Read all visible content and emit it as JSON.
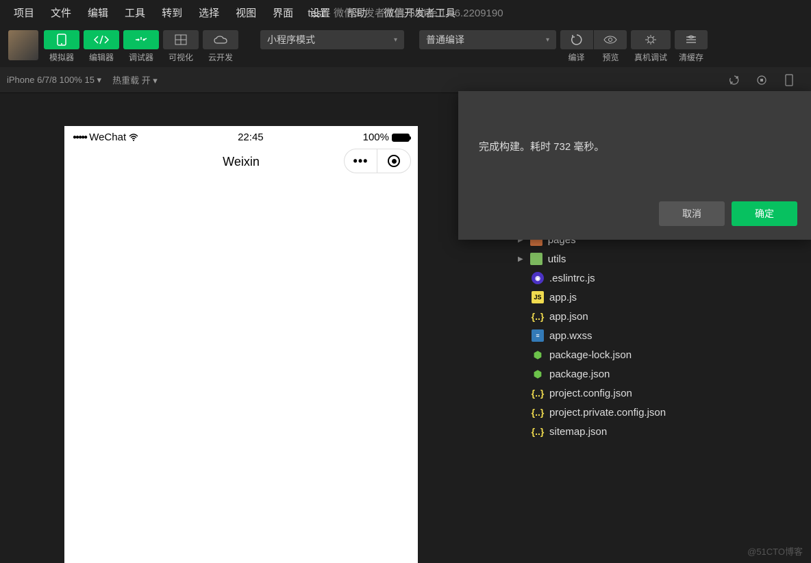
{
  "menubar": [
    "项目",
    "文件",
    "编辑",
    "工具",
    "转到",
    "选择",
    "视图",
    "界面",
    "设置",
    "帮助",
    "微信开发者工具"
  ],
  "window_title": {
    "project": "test",
    "suffix": " - 微信开发者工具 Stable 1.06.2209190"
  },
  "toolbar": {
    "simulator": "模拟器",
    "editor": "编辑器",
    "debugger": "调试器",
    "visualize": "可视化",
    "cloud": "云开发",
    "mode_dropdown": "小程序模式",
    "compile_dropdown": "普通编译",
    "compile": "编译",
    "preview": "预览",
    "real_device": "真机调试",
    "clear_cache": "清缓存"
  },
  "subbar": {
    "device": "iPhone 6/7/8 100% 15 ▾",
    "hot_reload": "热重载 开 ▾"
  },
  "phone": {
    "carrier": "WeChat",
    "time": "22:45",
    "battery": "100%",
    "page_title": "Weixin"
  },
  "modal": {
    "message": "完成构建。耗时 732 毫秒。",
    "cancel": "取消",
    "ok": "确定"
  },
  "tree": {
    "folders": [
      {
        "name": "pages",
        "color": "o"
      },
      {
        "name": "utils",
        "color": "g"
      }
    ],
    "files": [
      {
        "name": ".eslintrc.js",
        "icon": "eslint"
      },
      {
        "name": "app.js",
        "icon": "js"
      },
      {
        "name": "app.json",
        "icon": "json"
      },
      {
        "name": "app.wxss",
        "icon": "wxss"
      },
      {
        "name": "package-lock.json",
        "icon": "node"
      },
      {
        "name": "package.json",
        "icon": "node"
      },
      {
        "name": "project.config.json",
        "icon": "json"
      },
      {
        "name": "project.private.config.json",
        "icon": "json"
      },
      {
        "name": "sitemap.json",
        "icon": "json"
      }
    ]
  },
  "watermark": "@51CTO博客"
}
